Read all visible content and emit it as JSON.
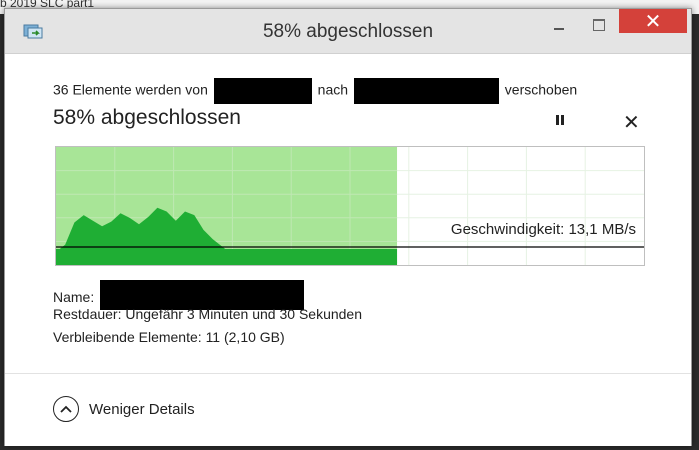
{
  "background": {
    "text": "b 2019 SLC part1"
  },
  "window": {
    "title": "58% abgeschlossen",
    "controls": {
      "minimize_icon": "minimize-icon",
      "maximize_icon": "maximize-icon",
      "close_icon": "close-icon"
    }
  },
  "transfer": {
    "prefix": "36 Elemente werden von",
    "middle": "nach",
    "suffix": "verschoben",
    "heading": "58% abgeschlossen",
    "percent_complete": 58
  },
  "graph": {
    "speed_label": "Geschwindigkeit: 13,1 MB/s",
    "progress_fraction": 0.58,
    "speed_history_relative": [
      0.12,
      0.2,
      0.44,
      0.52,
      0.46,
      0.4,
      0.45,
      0.54,
      0.49,
      0.42,
      0.5,
      0.6,
      0.56,
      0.46,
      0.56,
      0.52,
      0.36,
      0.26,
      0.18,
      0.1,
      0.02,
      0.04,
      0.03,
      0.04,
      0.03,
      0.05,
      0.03,
      0.04,
      0.05,
      0.03,
      0.04,
      0.05,
      0.03,
      0.05,
      0.06,
      0.04,
      0.05,
      0.03
    ],
    "colors": {
      "done_area": "#a8e597",
      "speed_fill": "#1fae34",
      "grid": "#e6f2e3",
      "speed_line": "#000000"
    }
  },
  "details": {
    "name_label": "Name:",
    "remaining_time_label": "Restdauer:",
    "remaining_time_value": "Ungefähr 3 Minuten und 30 Sekunden",
    "remaining_items_label": "Verbleibende Elemente:",
    "remaining_items_value": "11 (2,10 GB)"
  },
  "footer": {
    "toggle_label": "Weniger Details",
    "toggle_icon": "chevron-up-icon"
  }
}
